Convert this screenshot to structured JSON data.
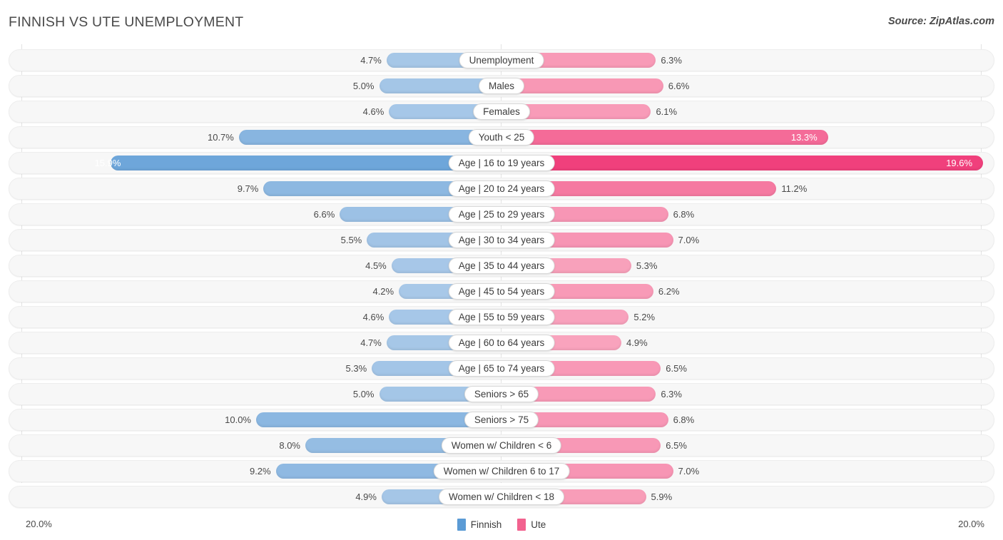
{
  "header": {
    "title": "FINNISH VS UTE UNEMPLOYMENT",
    "source": "Source: ZipAtlas.com"
  },
  "legend": {
    "items": [
      {
        "label": "Finnish",
        "color": "#5B9BD5"
      },
      {
        "label": "Ute",
        "color": "#F2628F"
      }
    ]
  },
  "axis": {
    "left_label": "20.0%",
    "right_label": "20.0%",
    "max": 20.0
  },
  "chart_data": {
    "type": "bar",
    "title": "FINNISH VS UTE UNEMPLOYMENT",
    "subtitle": "Source: ZipAtlas.com",
    "orientation": "horizontal-diverging",
    "xlabel": "",
    "ylabel": "",
    "xlim": [
      0,
      20.0
    ],
    "grid": true,
    "legend_position": "bottom-center",
    "categories": [
      "Unemployment",
      "Males",
      "Females",
      "Youth < 25",
      "Age | 16 to 19 years",
      "Age | 20 to 24 years",
      "Age | 25 to 29 years",
      "Age | 30 to 34 years",
      "Age | 35 to 44 years",
      "Age | 45 to 54 years",
      "Age | 55 to 59 years",
      "Age | 60 to 64 years",
      "Age | 65 to 74 years",
      "Seniors > 65",
      "Seniors > 75",
      "Women w/ Children < 6",
      "Women w/ Children 6 to 17",
      "Women w/ Children < 18"
    ],
    "series": [
      {
        "name": "Finnish",
        "color": "#5B9BD5",
        "values": [
          4.7,
          5.0,
          4.6,
          10.7,
          15.9,
          9.7,
          6.6,
          5.5,
          4.5,
          4.2,
          4.6,
          4.7,
          5.3,
          5.0,
          10.0,
          8.0,
          9.2,
          4.9
        ],
        "labels": [
          "4.7%",
          "5.0%",
          "4.6%",
          "10.7%",
          "15.9%",
          "9.7%",
          "6.6%",
          "5.5%",
          "4.5%",
          "4.2%",
          "4.6%",
          "4.7%",
          "5.3%",
          "5.0%",
          "10.0%",
          "8.0%",
          "9.2%",
          "4.9%"
        ]
      },
      {
        "name": "Ute",
        "color": "#F2628F",
        "values": [
          6.3,
          6.6,
          6.1,
          13.3,
          19.6,
          11.2,
          6.8,
          7.0,
          5.3,
          6.2,
          5.2,
          4.9,
          6.5,
          6.3,
          6.8,
          6.5,
          7.0,
          5.9
        ],
        "labels": [
          "6.3%",
          "6.6%",
          "6.1%",
          "13.3%",
          "19.6%",
          "11.2%",
          "6.8%",
          "7.0%",
          "5.3%",
          "6.2%",
          "5.2%",
          "4.9%",
          "6.5%",
          "6.3%",
          "6.8%",
          "6.5%",
          "7.0%",
          "5.9%"
        ]
      }
    ]
  }
}
